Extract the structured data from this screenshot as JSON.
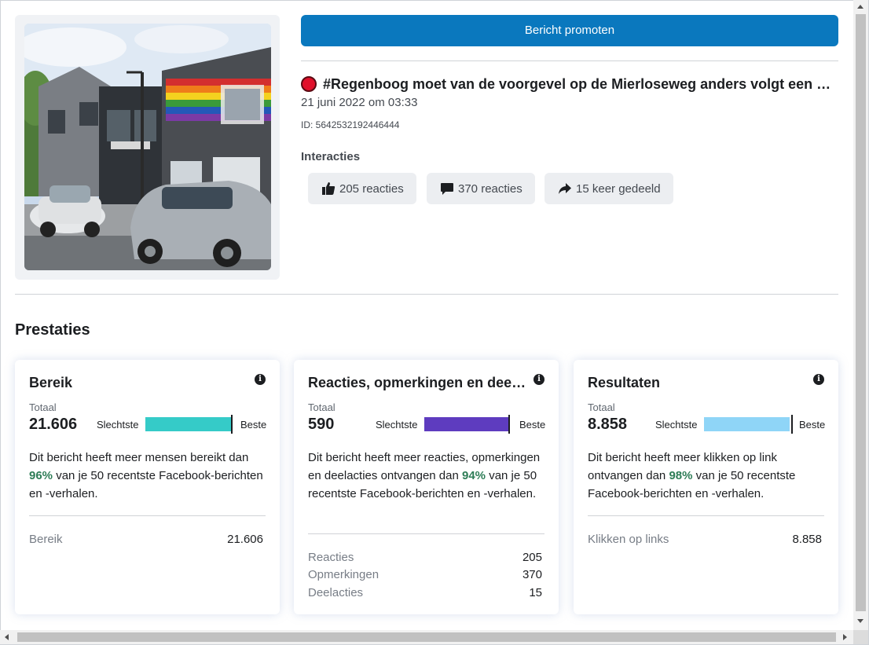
{
  "promote_button": "Bericht promoten",
  "post": {
    "title": "#Regenboog moet van de voorgevel op de Mierloseweg anders volgt een boete",
    "date": "21 juni 2022 om 03:33",
    "id": "ID: 5642532192446444",
    "image_alt": "Winkelpand met regenboogvlag op de gevel en geparkeerde auto's",
    "interactions_label": "Interacties",
    "interactions": [
      {
        "icon": "thumbs-up-icon",
        "label": "205 reacties"
      },
      {
        "icon": "comment-icon",
        "label": "370 reacties"
      },
      {
        "icon": "share-icon",
        "label": "15 keer gedeeld"
      }
    ]
  },
  "performance": {
    "title": "Prestaties",
    "cards": [
      {
        "title": "Bereik",
        "total_label": "Totaal",
        "total": "21.606",
        "worst": "Slechtste",
        "best": "Beste",
        "bar_color": "#35cbc8",
        "bar_fill": 1.0,
        "desc_before": "Dit bericht heeft meer mensen bereikt dan ",
        "percent": "96%",
        "desc_after": " van je 50 recentste Facebook-berichten en -verhalen.",
        "metrics": [
          {
            "label": "Bereik",
            "value": "21.606"
          }
        ]
      },
      {
        "title": "Reacties, opmerkingen en deelacties",
        "total_label": "Totaal",
        "total": "590",
        "worst": "Slechtste",
        "best": "Beste",
        "bar_color": "#5e3cbf",
        "bar_fill": 0.98,
        "desc_before": "Dit bericht heeft meer reacties, opmerkingen en deelacties ontvangen dan ",
        "percent": "94%",
        "desc_after": " van je 50 recentste Facebook-berichten en -verhalen.",
        "metrics": [
          {
            "label": "Reacties",
            "value": "205"
          },
          {
            "label": "Opmerkingen",
            "value": "370"
          },
          {
            "label": "Deelacties",
            "value": "15"
          }
        ]
      },
      {
        "title": "Resultaten",
        "total_label": "Totaal",
        "total": "8.858",
        "worst": "Slechtste",
        "best": "Beste",
        "bar_color": "#8fd5f7",
        "bar_fill": 1.0,
        "desc_before": "Dit bericht heeft meer klikken op link ontvangen dan ",
        "percent": "98%",
        "desc_after": " van je 50 recentste Facebook-berichten en -verhalen.",
        "metrics": [
          {
            "label": "Klikken op links",
            "value": "8.858"
          }
        ]
      }
    ]
  }
}
